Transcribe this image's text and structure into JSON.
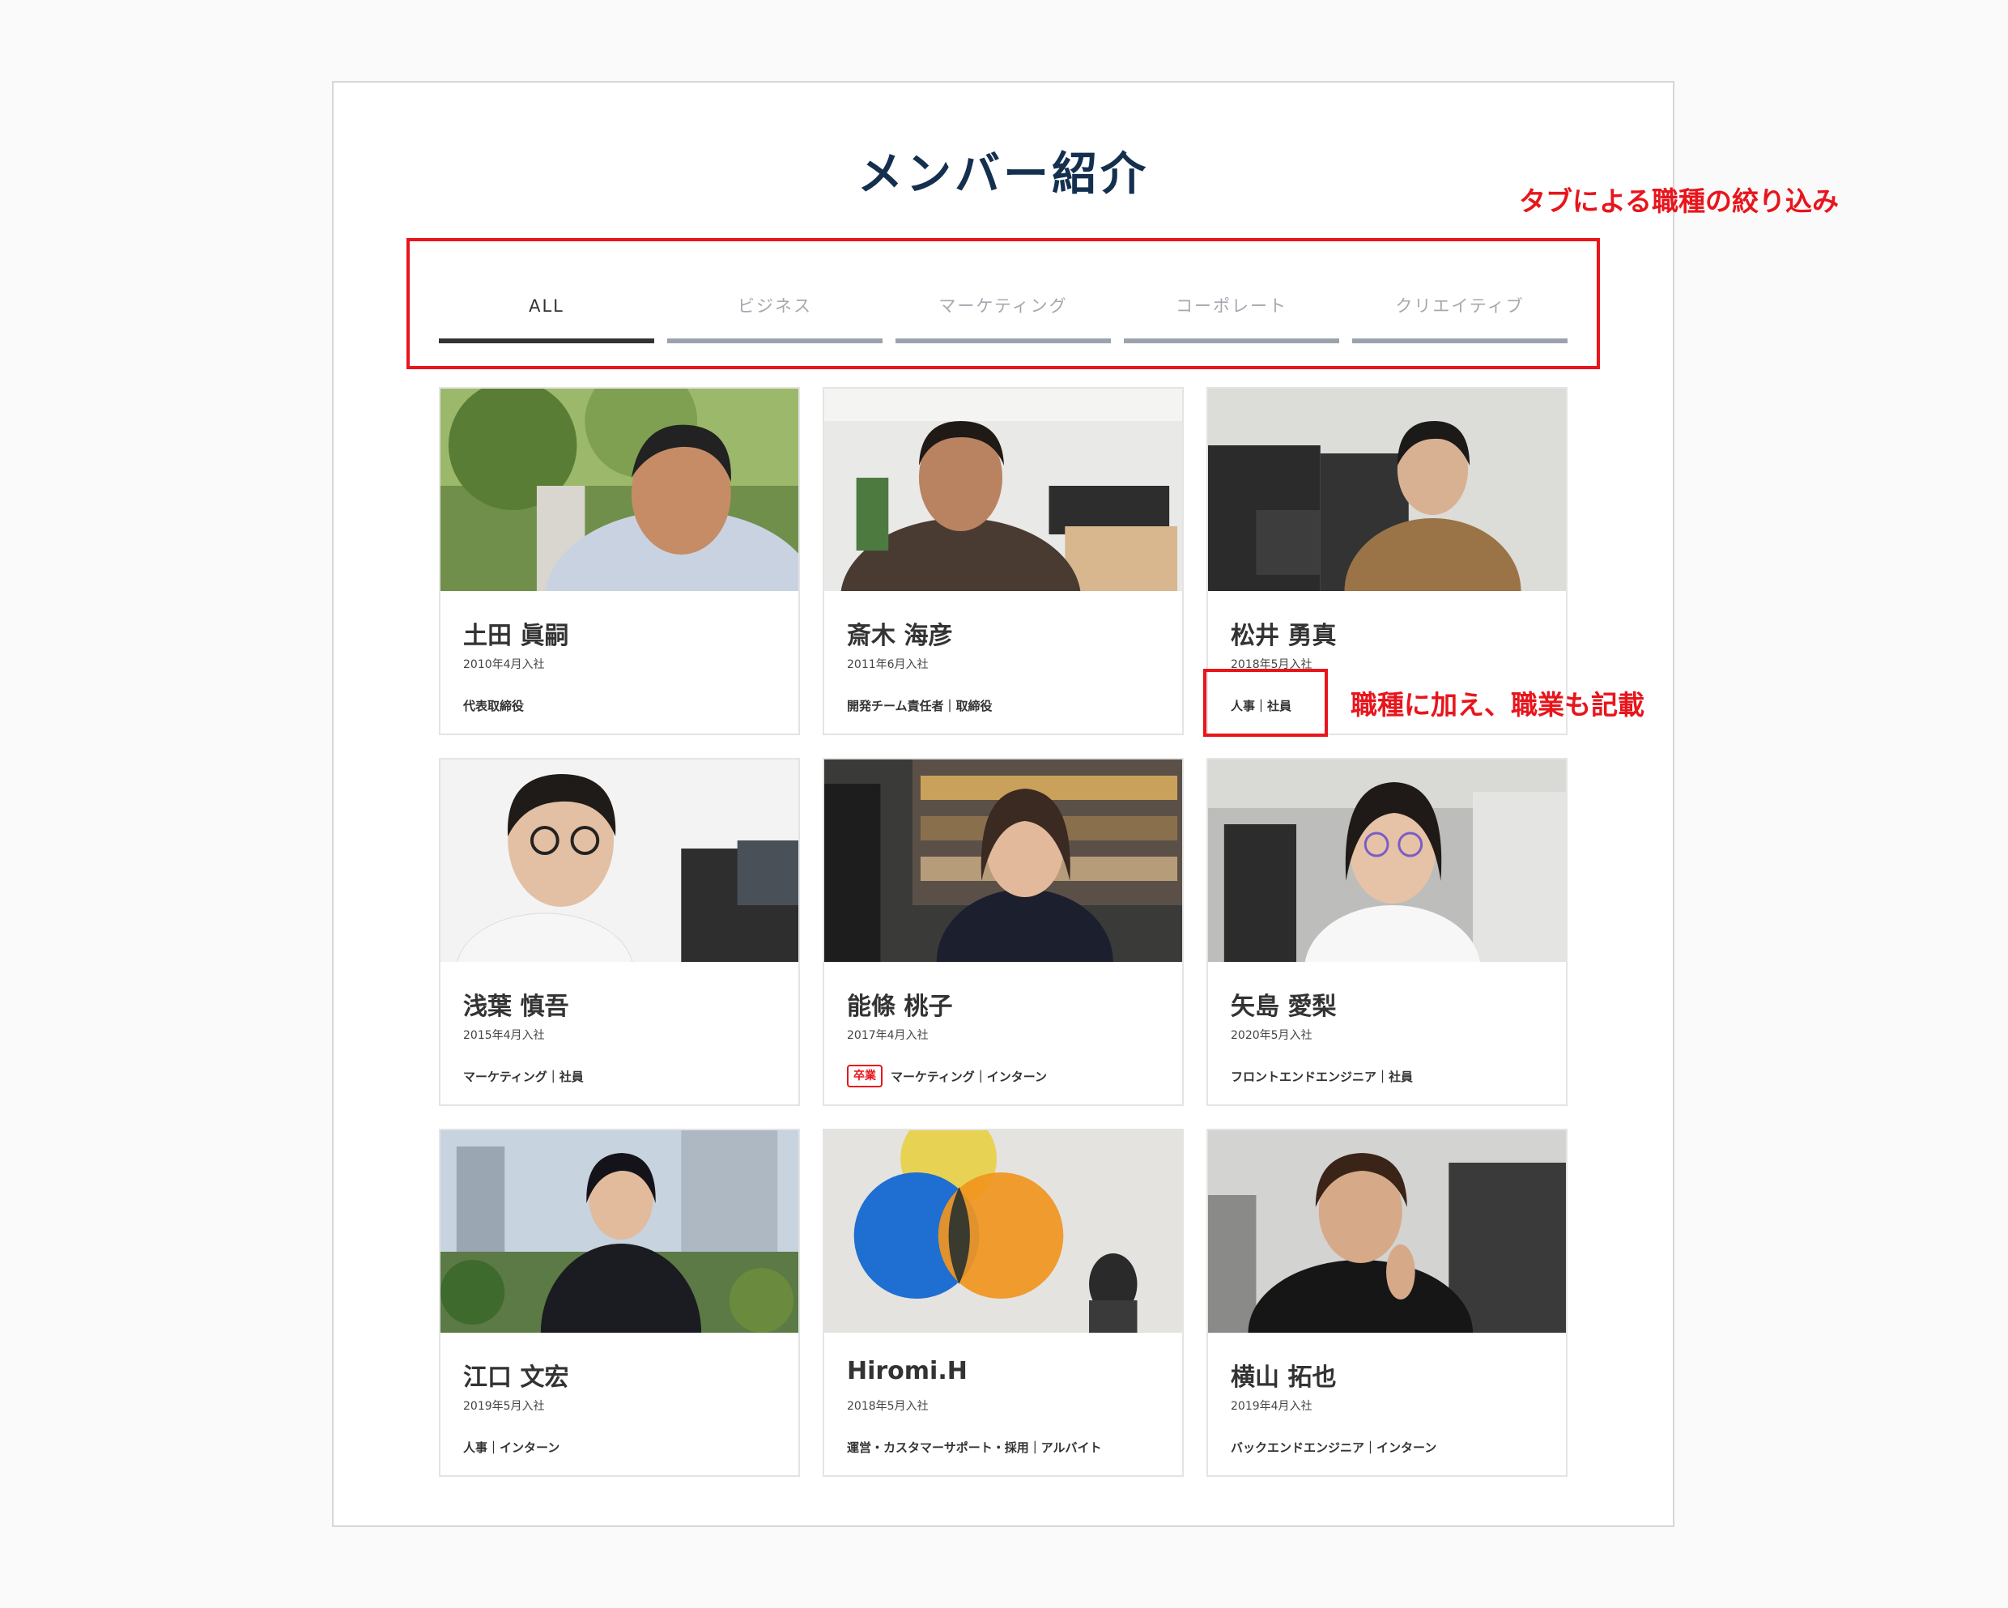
{
  "page": {
    "title": "メンバー紹介"
  },
  "tabs": [
    {
      "label": "ALL",
      "active": true
    },
    {
      "label": "ビジネス",
      "active": false
    },
    {
      "label": "マーケティング",
      "active": false
    },
    {
      "label": "コーポレート",
      "active": false
    },
    {
      "label": "クリエイティブ",
      "active": false
    }
  ],
  "annotations": {
    "tabs_note": "タブによる職種の絞り込み",
    "role_note": "職種に加え、職業も記載",
    "color": "#e8151c"
  },
  "members": [
    {
      "name": "土田 眞嗣",
      "joined": "2010年4月入社",
      "role": "代表取締役",
      "badge": ""
    },
    {
      "name": "斎木 海彦",
      "joined": "2011年6月入社",
      "role": "開発チーム責任者｜取締役",
      "badge": ""
    },
    {
      "name": "松井 勇真",
      "joined": "2018年5月入社",
      "role": "人事｜社員",
      "badge": ""
    },
    {
      "name": "浅葉 慎吾",
      "joined": "2015年4月入社",
      "role": "マーケティング｜社員",
      "badge": ""
    },
    {
      "name": "能條 桃子",
      "joined": "2017年4月入社",
      "role": "マーケティング｜インターン",
      "badge": "卒業"
    },
    {
      "name": "矢島 愛梨",
      "joined": "2020年5月入社",
      "role": "フロントエンドエンジニア｜社員",
      "badge": ""
    },
    {
      "name": "江口 文宏",
      "joined": "2019年5月入社",
      "role": "人事｜インターン",
      "badge": ""
    },
    {
      "name": "Hiromi.H",
      "joined": "2018年5月入社",
      "role": "運営・カスタマーサポート・採用｜アルバイト",
      "badge": ""
    },
    {
      "name": "横山 拓也",
      "joined": "2019年4月入社",
      "role": "バックエンドエンジニア｜インターン",
      "badge": ""
    }
  ],
  "colors": {
    "title": "#14304e",
    "tab_active": "#333333",
    "tab_inactive": "#9aa3ad"
  }
}
